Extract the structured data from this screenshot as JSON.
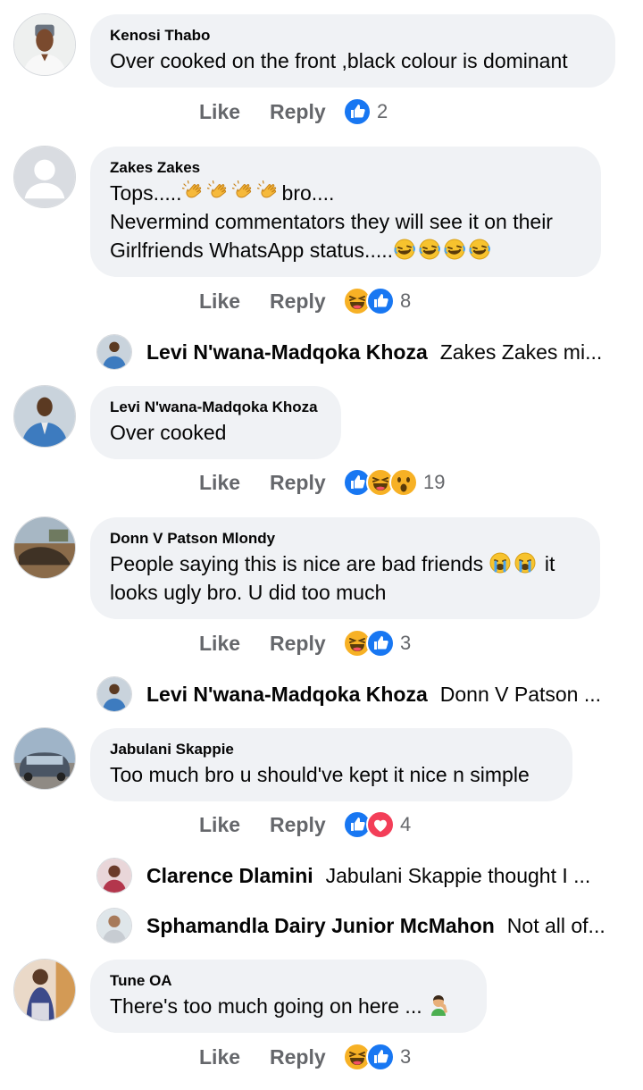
{
  "actions": {
    "like_label": "Like",
    "reply_label": "Reply"
  },
  "comments": [
    {
      "author": "Kenosi Thabo",
      "text": "Over cooked on the front ,black colour is dominant",
      "reaction_count": "2",
      "reactions": [
        "like"
      ]
    },
    {
      "author": "Zakes Zakes",
      "text_line1_a": "Tops.....",
      "text_line1_b": "bro....",
      "text_line2": "Nevermind commentators they will see it on their",
      "text_line3": "Girlfriends WhatsApp status.....",
      "reaction_count": "8",
      "reactions": [
        "haha",
        "like"
      ],
      "emoji_line1": [
        "clapping-hands",
        "clapping-hands",
        "clapping-hands",
        "clapping-hands"
      ],
      "emoji_line3": [
        "rolling-laughing",
        "rolling-laughing",
        "rolling-laughing",
        "rolling-laughing"
      ]
    },
    {
      "author": "Levi N'wana-Madqoka Khoza",
      "text": "Over cooked",
      "reaction_count": "19",
      "reactions": [
        "like",
        "haha",
        "wow"
      ]
    },
    {
      "author": "Donn V Patson Mlondy",
      "text_line1_a": "People saying this is nice are bad friends",
      "text_line1_b": "it",
      "text_line2": "looks ugly bro. U did too much",
      "reaction_count": "3",
      "reactions": [
        "haha",
        "like"
      ],
      "emoji_line1": [
        "loudly-crying",
        "loudly-crying"
      ]
    },
    {
      "author": "Jabulani Skappie",
      "text": "Too much bro u should've kept it nice n simple",
      "reaction_count": "4",
      "reactions": [
        "like",
        "love"
      ]
    },
    {
      "author": "Tune OA",
      "text": "There's too much going on here ...",
      "reaction_count": "3",
      "reactions": [
        "haha",
        "like"
      ],
      "emoji": [
        "man-facepalming"
      ]
    }
  ],
  "reply_previews": [
    {
      "name": "Levi N'wana-Madqoka Khoza",
      "text": "Zakes Zakes mi..."
    },
    {
      "name": "Levi N'wana-Madqoka Khoza",
      "text": "Donn V Patson ..."
    },
    {
      "name": "Clarence Dlamini",
      "text": "Jabulani Skappie thought I ..."
    },
    {
      "name": "Sphamandla Dairy Junior McMahon",
      "text": "Not all of..."
    }
  ],
  "colors": {
    "bubble": "#f0f2f5",
    "like_blue": "#1877f2",
    "haha_yellow": "#f7b125",
    "love_red": "#f33e58",
    "muted_text": "#65676b"
  }
}
